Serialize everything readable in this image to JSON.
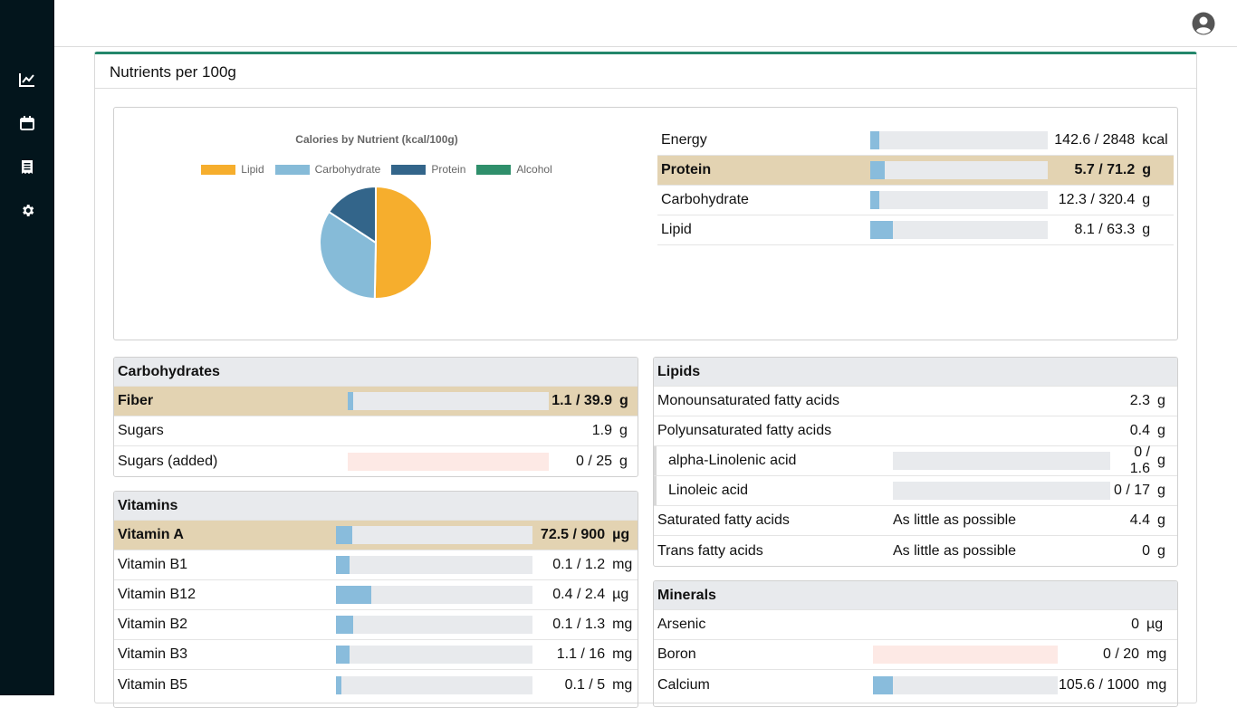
{
  "icons": {
    "nav": [
      "chart-line-icon",
      "calendar-icon",
      "receipt-icon",
      "gear-icon"
    ],
    "user": "user-circle-icon"
  },
  "colors": {
    "lipid": "#f6ae2d",
    "carbohydrate": "#86bbd8",
    "protein": "#33658a",
    "alcohol": "#2f8f6b",
    "accent": "#24876b",
    "highlight": "#e3d3b2"
  },
  "card": {
    "title": "Nutrients per 100g"
  },
  "chart_data": {
    "type": "pie",
    "title": "Calories by Nutrient (kcal/100g)",
    "legend": [
      "Lipid",
      "Carbohydrate",
      "Protein",
      "Alcohol"
    ],
    "legend_position": "top",
    "values": [
      72.9,
      49.2,
      22.8,
      0
    ]
  },
  "macros": [
    {
      "name": "Energy",
      "value": "142.6 / 2848",
      "unit": "kcal",
      "fraction": 0.05,
      "highlight": false
    },
    {
      "name": "Protein",
      "value": "5.7 / 71.2",
      "unit": "g",
      "fraction": 0.08,
      "highlight": true
    },
    {
      "name": "Carbohydrate",
      "value": "12.3 / 320.4",
      "unit": "g",
      "fraction": 0.04,
      "highlight": false
    },
    {
      "name": "Lipid",
      "value": "8.1 / 63.3",
      "unit": "g",
      "fraction": 0.128,
      "highlight": false
    }
  ],
  "carbohydrates": {
    "title": "Carbohydrates",
    "rows": [
      {
        "name": "Fiber",
        "value": "1.1 / 39.9",
        "unit": "g",
        "fraction": 0.028,
        "highlight": true
      },
      {
        "name": "Sugars",
        "value": "1.9",
        "unit": "g"
      },
      {
        "name": "Sugars (added)",
        "value": "0 / 25",
        "unit": "g",
        "fraction": 0,
        "limit": true
      }
    ]
  },
  "vitamins": {
    "title": "Vitamins",
    "rows": [
      {
        "name": "Vitamin A",
        "value": "72.5 / 900",
        "unit": "µg",
        "fraction": 0.08,
        "highlight": true
      },
      {
        "name": "Vitamin B1",
        "value": "0.1 / 1.2",
        "unit": "mg",
        "fraction": 0.07
      },
      {
        "name": "Vitamin B12",
        "value": "0.4 / 2.4",
        "unit": "µg",
        "fraction": 0.18
      },
      {
        "name": "Vitamin B2",
        "value": "0.1 / 1.3",
        "unit": "mg",
        "fraction": 0.085
      },
      {
        "name": "Vitamin B3",
        "value": "1.1 / 16",
        "unit": "mg",
        "fraction": 0.069
      },
      {
        "name": "Vitamin B5",
        "value": "0.1 / 5",
        "unit": "mg",
        "fraction": 0.02
      }
    ]
  },
  "lipids": {
    "title": "Lipids",
    "rows": [
      {
        "name": "Monounsaturated fatty acids",
        "value": "2.3",
        "unit": "g"
      },
      {
        "name": "Polyunsaturated fatty acids",
        "value": "0.4",
        "unit": "g"
      },
      {
        "name": "alpha-Linolenic acid",
        "value": "0 / 1.6",
        "unit": "g",
        "fraction": 0,
        "indent": true
      },
      {
        "name": "Linoleic acid",
        "value": "0 / 17",
        "unit": "g",
        "fraction": 0,
        "indent": true
      },
      {
        "name": "Saturated fatty acids",
        "note": "As little as possible",
        "value": "4.4",
        "unit": "g"
      },
      {
        "name": "Trans fatty acids",
        "note": "As little as possible",
        "value": "0",
        "unit": "g"
      }
    ]
  },
  "minerals": {
    "title": "Minerals",
    "rows": [
      {
        "name": "Arsenic",
        "value": "0",
        "unit": "µg"
      },
      {
        "name": "Boron",
        "value": "0 / 20",
        "unit": "mg",
        "fraction": 0,
        "limit": true
      },
      {
        "name": "Calcium",
        "value": "105.6 / 1000",
        "unit": "mg",
        "fraction": 0.106
      }
    ]
  }
}
